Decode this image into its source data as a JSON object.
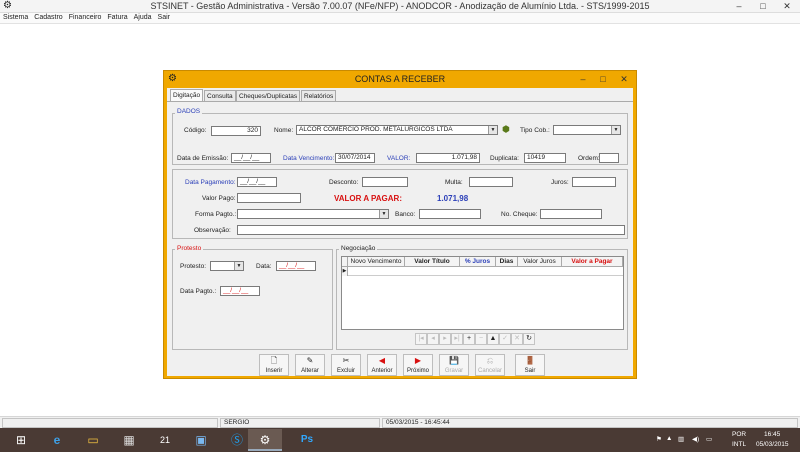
{
  "window": {
    "title": "STSINET - Gestão Administrativa - Versão 7.00.07 (NFe/NFP) - ANODCOR - Anodização de Alumínio Ltda. - STS/1999-2015",
    "minimize": "–",
    "maximize": "□",
    "close": "✕"
  },
  "menu": [
    "Sistema",
    "Cadastro",
    "Financeiro",
    "Fatura",
    "Ajuda",
    "Sair"
  ],
  "dialog": {
    "title": "CONTAS A RECEBER",
    "minimize": "–",
    "maximize": "□",
    "close": "✕",
    "tabs": [
      "Digitação",
      "Consulta",
      "Cheques/Duplicatas",
      "Relatórios"
    ]
  },
  "dados": {
    "legend": "DADOS",
    "codigo_label": "Código:",
    "codigo": "320",
    "nome_label": "Nome:",
    "nome": "ALCOR COMERCIO PROD. METALURGICOS LTDA",
    "tipo_cob_label": "Tipo Cob.:",
    "tipo_cob": "",
    "data_emissao_label": "Data de Emissão:",
    "data_emissao": "__/__/__",
    "data_venc_label": "Data Vencimento:",
    "data_venc": "30/07/2014",
    "valor_label": "VALOR:",
    "valor": "1.071,98",
    "duplicata_label": "Duplicata:",
    "duplicata": "10419",
    "ordem_label": "Ordem:",
    "ordem": ""
  },
  "pagamento": {
    "data_pag_label": "Data Pagamento:",
    "data_pag": "__/__/__",
    "desconto_label": "Desconto:",
    "desconto": "",
    "multa_label": "Multa:",
    "multa": "",
    "juros_label": "Juros:",
    "juros": "",
    "valor_pago_label": "Valor Pago:",
    "valor_pago": "",
    "valor_a_pagar_label": "VALOR A PAGAR:",
    "valor_a_pagar": "1.071,98",
    "forma_pagto_label": "Forma Pagto.:",
    "forma_pagto": "",
    "banco_label": "Banco:",
    "banco": "",
    "no_cheque_label": "No. Cheque:",
    "no_cheque": "",
    "observacao_label": "Observação:",
    "observacao": ""
  },
  "protesto": {
    "legend": "Protesto",
    "protesto_label": "Protesto:",
    "protesto": "",
    "data_label": "Data:",
    "data": "__/__/__",
    "data_pagto_label": "Data Pagto.:",
    "data_pagto": "__/__/__"
  },
  "negociacao": {
    "legend": "Negociação",
    "columns": [
      "Novo Vencimento",
      "Valor Título",
      "% Juros",
      "Dias",
      "Valor Juros",
      "Valor a Pagar"
    ],
    "nav": [
      "|◂",
      "◂",
      "▸",
      "▸|",
      "+",
      "−",
      "▲",
      "✓",
      "✕",
      "↻"
    ]
  },
  "toolbar": [
    {
      "label": "Inserir",
      "icon": "🗋"
    },
    {
      "label": "Alterar",
      "icon": "✎"
    },
    {
      "label": "Excluir",
      "icon": "✂"
    },
    {
      "label": "Anterior",
      "icon": "◀"
    },
    {
      "label": "Próximo",
      "icon": "▶"
    },
    {
      "label": "Gravar",
      "icon": "💾"
    },
    {
      "label": "Cancelar",
      "icon": "⎌"
    },
    {
      "label": "Sair",
      "icon": "🚪"
    }
  ],
  "status": {
    "user": "SERGIO",
    "datetime": "05/03/2015 - 16:45:44"
  },
  "taskbar": {
    "lang": "POR",
    "layout": "INTL",
    "time": "16:45",
    "date": "05/03/2015",
    "calendar_day": "21"
  },
  "colors": {
    "dialog_frame": "#f0a800",
    "label_blue": "#2b3fb8",
    "label_red": "#d81010",
    "taskbar": "#4a3a34"
  }
}
